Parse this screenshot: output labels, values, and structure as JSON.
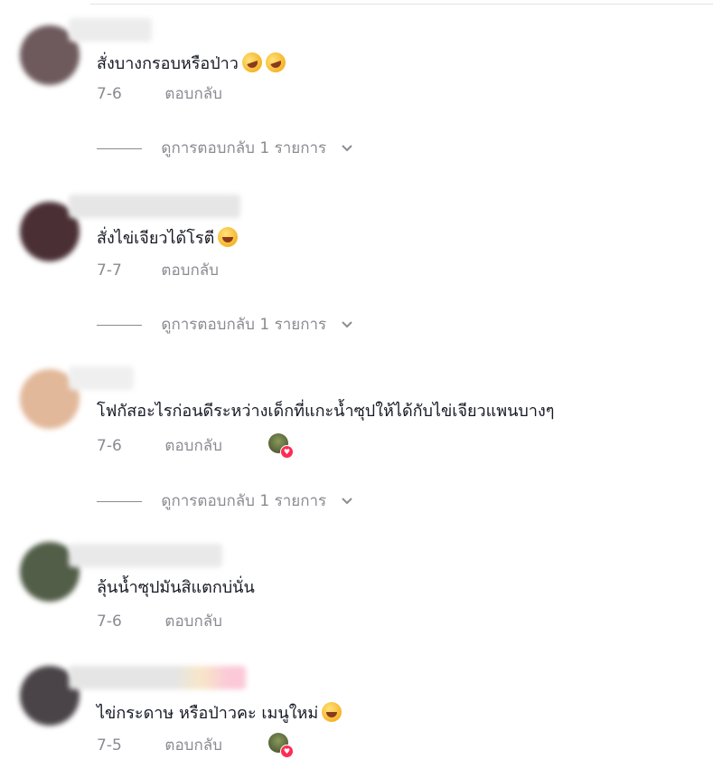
{
  "comments": [
    {
      "text": "สั่งบางกรอบหรือป่าว",
      "emoji": [
        "rolling-laughing-emoji",
        "rolling-laughing-emoji"
      ],
      "date": "7-6",
      "reply_label": "ตอบกลับ",
      "view_replies": "ดูการตอบกลับ 1 รายการ",
      "avatar_color": "#6e5a5c"
    },
    {
      "text": "สั่งไข่เจียวได้โรตี",
      "emoji": [
        "grinning-squinting-emoji"
      ],
      "date": "7-7",
      "reply_label": "ตอบกลับ",
      "view_replies": "ดูการตอบกลับ 1 รายการ",
      "avatar_color": "#4a3035"
    },
    {
      "text": "โฟกัสอะไรก่อนดีระหว่างเด็กที่แกะน้ำซุปให้ได้กับไข่เจียวแพนบางๆ",
      "date": "7-6",
      "reply_label": "ตอบกลับ",
      "view_replies": "ดูการตอบกลับ 1 รายการ",
      "avatar_color": "#e2b89a",
      "liked_by_creator": true
    },
    {
      "text": "ลุ้นน้ำซุปมันสิแตกบ่นั่น",
      "date": "7-6",
      "reply_label": "ตอบกลับ",
      "avatar_color": "#525e48"
    },
    {
      "text": "ไข่กระดาษ หรือป่าวคะ เมนูใหม่",
      "emoji": [
        "grinning-sweat-emoji"
      ],
      "date": "7-5",
      "reply_label": "ตอบกลับ",
      "avatar_color": "#4a4448",
      "liked_by_creator": true
    }
  ],
  "colors": {
    "text": "#161823",
    "muted": "#8a8b91",
    "like_heart": "#fe2c55"
  }
}
